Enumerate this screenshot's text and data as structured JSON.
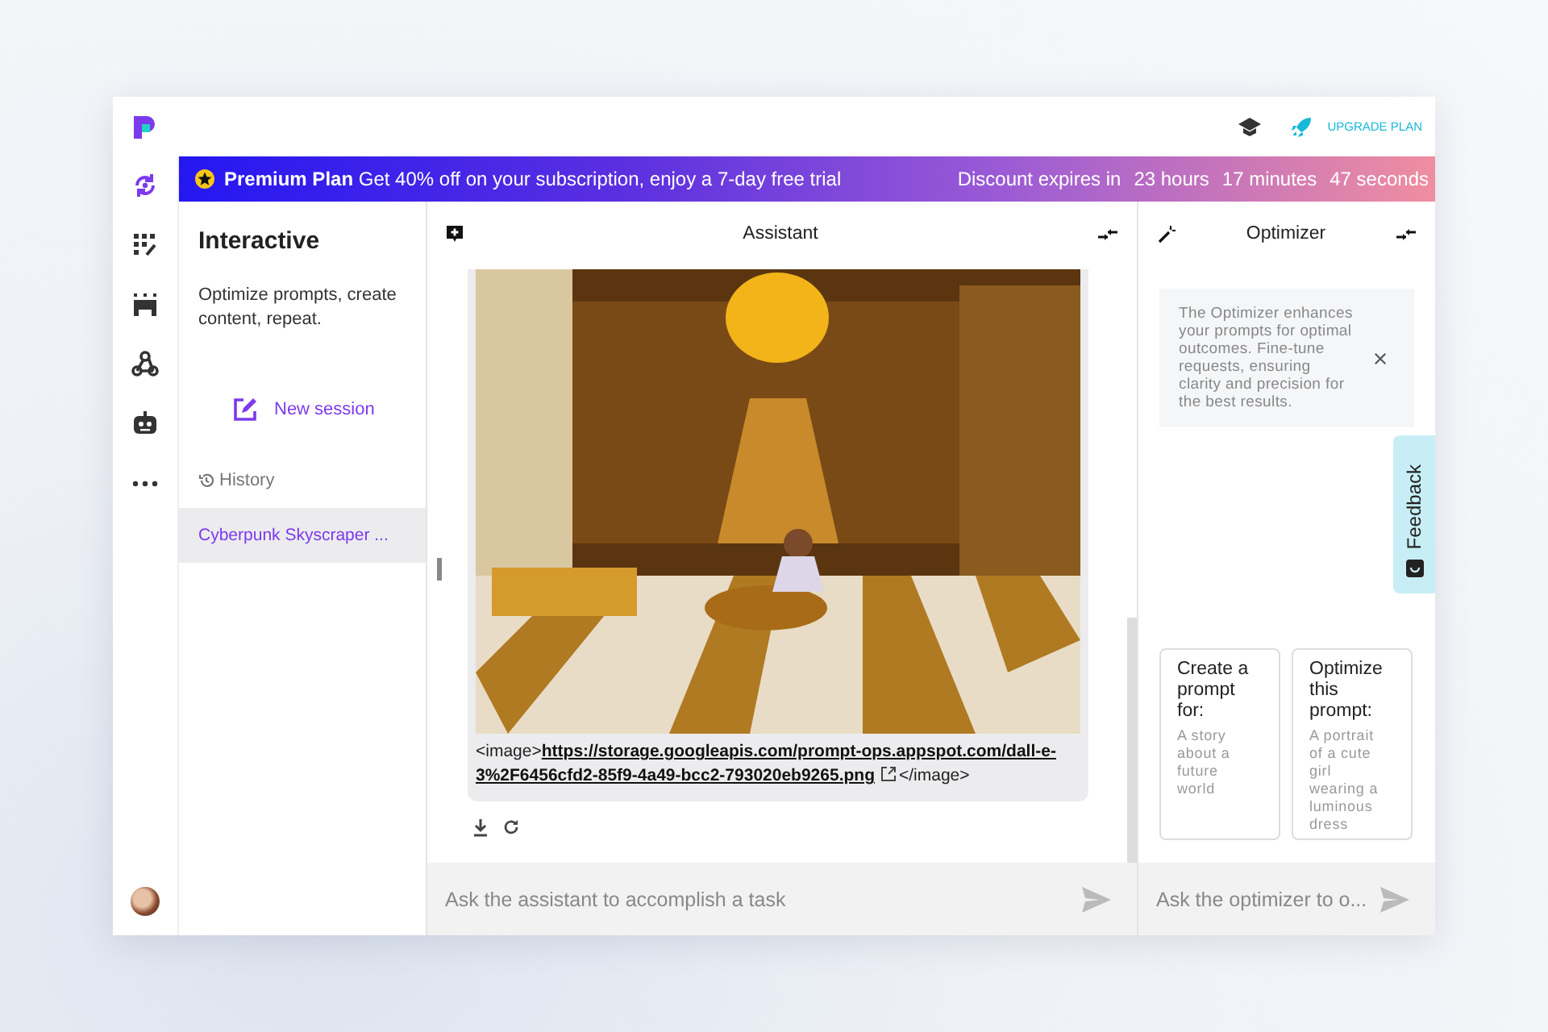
{
  "top_bar": {
    "upgrade_label": "UPGRADE PLAN"
  },
  "promo_banner": {
    "title": "Premium Plan",
    "text": "Get 40% off on your subscription, enjoy a 7-day free trial",
    "countdown_label": "Discount expires in",
    "countdown": [
      "23 hours",
      "17 minutes",
      "47 seconds"
    ]
  },
  "nav_rail": {
    "items": [
      {
        "kind": "sync",
        "selected": true
      },
      {
        "kind": "grid",
        "selected": false
      },
      {
        "kind": "store",
        "selected": false
      },
      {
        "kind": "webhook",
        "selected": false
      },
      {
        "kind": "robot",
        "selected": false
      },
      {
        "kind": "more",
        "selected": false
      }
    ]
  },
  "sidebar": {
    "title": "Interactive",
    "subtitle": "Optimize prompts, create content, repeat.",
    "new_session": "New session",
    "history_label": "History",
    "sessions": [
      {
        "title": "Cyberpunk Skyscraper ...",
        "selected": true
      }
    ]
  },
  "assistant": {
    "title": "Assistant",
    "message": {
      "prefix": "<image>",
      "link": "https://storage.googleapis.com/prompt-ops.appspot.com/dall-e-3%2F6456cfd2-85f9-4a49-bcc2-793020eb9265.png",
      "suffix": "</image>"
    },
    "composer_placeholder": "Ask the assistant to accomplish a task"
  },
  "optimizer": {
    "title": "Optimizer",
    "info": "The Optimizer enhances your prompts for optimal outcomes. Fine-tune requests, ensuring clarity and precision for the best results.",
    "suggestions": [
      {
        "title": "Create a prompt for:",
        "example": "A story about a future world"
      },
      {
        "title": "Optimize this prompt:",
        "example": "A portrait of a cute girl wearing a luminous dress"
      }
    ],
    "composer_placeholder": "Ask the optimizer to o..."
  },
  "feedback": {
    "label": "Feedback"
  }
}
